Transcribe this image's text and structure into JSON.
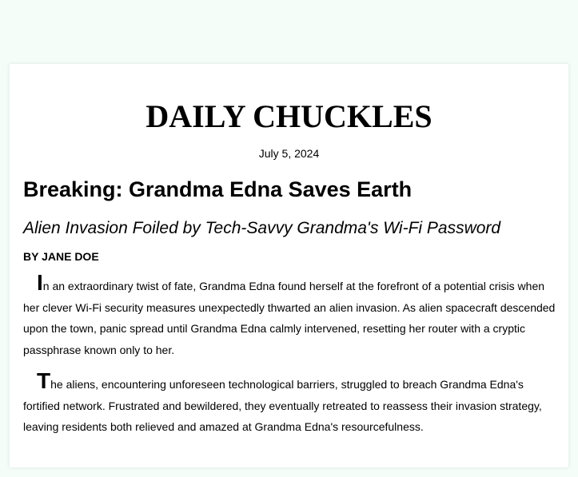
{
  "newspaper": {
    "masthead": "DAILY CHUCKLES",
    "date": "July 5, 2024"
  },
  "article": {
    "headline": "Breaking: Grandma Edna Saves Earth",
    "subheadline": "Alien Invasion Foiled by Tech-Savvy Grandma's Wi-Fi Password",
    "byline": "BY JANE DOE",
    "paragraphs": [
      {
        "dropcap": "I",
        "text": "n an extraordinary twist of fate, Grandma Edna found herself at the forefront of a potential crisis when her clever Wi-Fi security measures unexpectedly thwarted an alien invasion. As alien spacecraft descended upon the town, panic spread until Grandma Edna calmly intervened, resetting her router with a cryptic passphrase known only to her."
      },
      {
        "dropcap": "T",
        "text": "he aliens, encountering unforeseen technological barriers, struggled to breach Grandma Edna's fortified network. Frustrated and bewildered, they eventually retreated to reassess their invasion strategy, leaving residents both relieved and amazed at Grandma Edna's resourcefulness."
      }
    ]
  }
}
